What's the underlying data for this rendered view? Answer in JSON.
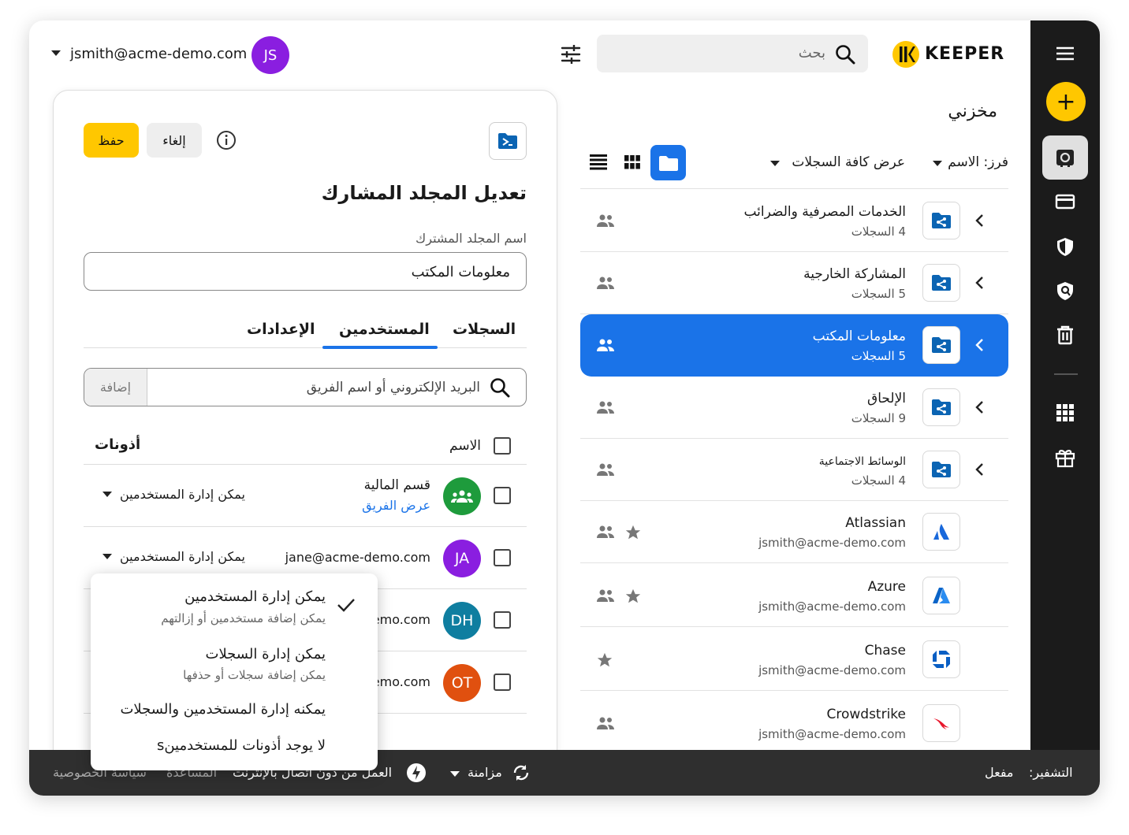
{
  "header": {
    "brand": "KEEPER",
    "search_placeholder": "بحث",
    "user_email": "jsmith@acme-demo.com",
    "user_initials": "JS"
  },
  "vault": {
    "title": "مخزني",
    "sort_label": "فرز: الاسم",
    "filter_label": "عرض كافة السجلات",
    "rows": [
      {
        "title": "الخدمات المصرفية والضرائب",
        "subtitle": "4 السجلات",
        "kind": "shared-folder",
        "starred": false,
        "shared": true
      },
      {
        "title": "المشاركة الخارجية",
        "subtitle": "5 السجلات",
        "kind": "shared-folder",
        "starred": false,
        "shared": true
      },
      {
        "title": "معلومات المكتب",
        "subtitle": "5 السجلات",
        "kind": "shared-folder",
        "starred": false,
        "shared": true,
        "selected": true
      },
      {
        "title": "الإلحاق",
        "subtitle": "9 السجلات",
        "kind": "shared-folder",
        "starred": false,
        "shared": true
      },
      {
        "title": "الوسائط الاجتماعية",
        "subtitle": "4 السجلات",
        "kind": "shared-folder",
        "starred": false,
        "shared": true
      },
      {
        "title": "Atlassian",
        "subtitle": "jsmith@acme-demo.com",
        "kind": "atlassian",
        "starred": true,
        "shared": true
      },
      {
        "title": "Azure",
        "subtitle": "jsmith@acme-demo.com",
        "kind": "azure",
        "starred": true,
        "shared": true
      },
      {
        "title": "Chase",
        "subtitle": "jsmith@acme-demo.com",
        "kind": "chase",
        "starred": true,
        "shared": false
      },
      {
        "title": "Crowdstrike",
        "subtitle": "jsmith@acme-demo.com",
        "kind": "crowdstrike",
        "starred": false,
        "shared": true
      }
    ]
  },
  "editor": {
    "save_label": "حفظ",
    "cancel_label": "إلغاء",
    "heading": "تعديل المجلد المشارك",
    "name_label": "اسم المجلد المشترك",
    "name_value": "معلومات المكتب",
    "tabs": [
      "السجلات",
      "المستخدمين",
      "الإعدادات"
    ],
    "active_tab": "المستخدمين",
    "search_placeholder": "البريد الإلكتروني أو اسم الفريق",
    "add_label": "إضافة",
    "col_name": "الاسم",
    "col_perms": "أذونات",
    "users": [
      {
        "name": "قسم المالية",
        "link": "عرض الفريق",
        "initials": "",
        "color": "#1e9b3c",
        "permission": "يمكن إدارة المستخدمين"
      },
      {
        "name": "jane@acme-demo.com",
        "initials": "JA",
        "color": "#8a1ee0",
        "permission": "يمكن إدارة المستخدمين"
      },
      {
        "name": "emo.com",
        "initials": "DH",
        "color": "#0f7ea0",
        "permission": ""
      },
      {
        "name": "emo.com",
        "initials": "OT",
        "color": "#e0500f",
        "permission": ""
      }
    ]
  },
  "dropdown": {
    "options": [
      {
        "title": "يمكن إدارة المستخدمين",
        "desc": "يمكن إضافة مستخدمين أو إزالتهم",
        "checked": true
      },
      {
        "title": "يمكن إدارة السجلات",
        "desc": "يمكن إضافة سجلات أو حذفها",
        "checked": false
      },
      {
        "title": "يمكنه إدارة المستخدمين والسجلات",
        "desc": "",
        "checked": false
      },
      {
        "title": "لا يوجد أذونات للمستخدمينs",
        "desc": "",
        "checked": false
      }
    ]
  },
  "status": {
    "encryption_label": "التشفير:",
    "encryption_value": "مفعل",
    "sync_label": "مزامنة",
    "offline_label": "العمل من دون اتصال بالإنترنت",
    "help_label": "المساعدة",
    "privacy_label": "سياسة الخصوصية"
  },
  "colors": {
    "accent": "#1a73e8",
    "brand_yellow": "#ffc700",
    "rail": "#1b1b1b",
    "status_bar": "#2f2f2f"
  }
}
